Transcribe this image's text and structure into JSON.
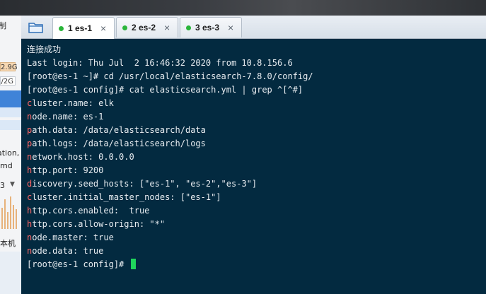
{
  "left_panel": {
    "top_text": "制",
    "box1": "2.9G",
    "box2": "/2G",
    "label1": "ation,",
    "label2": "md",
    "label3": "3",
    "label4": "本机"
  },
  "tabs": [
    {
      "label": "1 es-1",
      "status_color": "#2ab53a",
      "active": true
    },
    {
      "label": "2 es-2",
      "status_color": "#2ab53a",
      "active": false
    },
    {
      "label": "3 es-3",
      "status_color": "#2ab53a",
      "active": false
    }
  ],
  "terminal": {
    "lines": [
      {
        "first": "",
        "rest": "连接成功"
      },
      {
        "first": "",
        "rest": "Last login: Thu Jul  2 16:46:32 2020 from 10.8.156.6"
      },
      {
        "first": "",
        "rest": "[root@es-1 ~]# cd /usr/local/elasticsearch-7.8.0/config/"
      },
      {
        "first": "",
        "rest": "[root@es-1 config]# cat elasticsearch.yml | grep ^[^#]"
      },
      {
        "first": "c",
        "rest": "luster.name: elk"
      },
      {
        "first": "n",
        "rest": "ode.name: es-1"
      },
      {
        "first": "p",
        "rest": "ath.data: /data/elasticsearch/data"
      },
      {
        "first": "p",
        "rest": "ath.logs: /data/elasticsearch/logs"
      },
      {
        "first": "n",
        "rest": "etwork.host: 0.0.0.0"
      },
      {
        "first": "h",
        "rest": "ttp.port: 9200"
      },
      {
        "first": "d",
        "rest": "iscovery.seed_hosts: [\"es-1\", \"es-2\",\"es-3\"]"
      },
      {
        "first": "c",
        "rest": "luster.initial_master_nodes: [\"es-1\"]"
      },
      {
        "first": "h",
        "rest": "ttp.cors.enabled:  true"
      },
      {
        "first": "h",
        "rest": "ttp.cors.allow-origin: \"*\""
      },
      {
        "first": "n",
        "rest": "ode.master: true"
      },
      {
        "first": "n",
        "rest": "ode.data: true"
      },
      {
        "first": "",
        "rest": "[root@es-1 config]# "
      }
    ],
    "cursor_color": "#1fd55c"
  },
  "icons": {
    "folder": "folder-icon",
    "close": "close-icon",
    "status": "status-dot-icon"
  }
}
